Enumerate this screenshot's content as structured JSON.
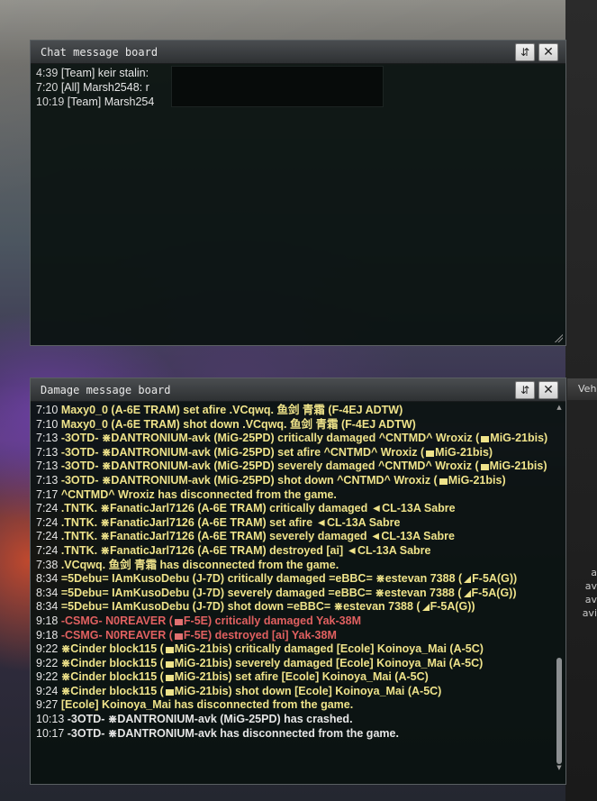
{
  "chat_board": {
    "title": "Chat message board",
    "sort_icon": "sort-arrows-icon",
    "close_icon": "close-icon",
    "messages": [
      {
        "time": "4:39",
        "text": "[Team] keir stalin:"
      },
      {
        "time": "7:20",
        "text": "[All] Marsh2548: r"
      },
      {
        "time": "10:19",
        "text": "[Team] Marsh254"
      }
    ]
  },
  "damage_board": {
    "title": "Damage message board",
    "lines": [
      {
        "time": "7:10",
        "parts": [
          "Maxy0_0 (A-6E TRAM) set afire .VCqwq. 鱼剑 青霜 (F-4EJ ADTW)"
        ],
        "style": "ally"
      },
      {
        "time": "7:10",
        "parts": [
          "Maxy0_0 (A-6E TRAM) shot down .VCqwq. 鱼剑 青霜 (F-4EJ ADTW)"
        ],
        "style": "ally"
      },
      {
        "time": "7:13",
        "parts": [
          "-3OTD- ⋇DANTRONIUM-avk (MiG-25PD) critically damaged ^CNTMD^ Wroxiz (",
          "MiG-21bis)"
        ],
        "icon": "square",
        "style": "ally"
      },
      {
        "time": "7:13",
        "parts": [
          "-3OTD- ⋇DANTRONIUM-avk (MiG-25PD) set afire ^CNTMD^ Wroxiz (",
          "MiG-21bis)"
        ],
        "icon": "square",
        "style": "ally"
      },
      {
        "time": "7:13",
        "parts": [
          "-3OTD- ⋇DANTRONIUM-avk (MiG-25PD) severely damaged ^CNTMD^ Wroxiz (",
          "MiG-21bis)"
        ],
        "icon": "square",
        "style": "ally"
      },
      {
        "time": "7:13",
        "parts": [
          "-3OTD- ⋇DANTRONIUM-avk (MiG-25PD) shot down ^CNTMD^ Wroxiz (",
          "MiG-21bis)"
        ],
        "icon": "square",
        "style": "ally"
      },
      {
        "time": "7:17",
        "parts": [
          "^CNTMD^ Wroxiz has disconnected from the game."
        ],
        "style": "ally"
      },
      {
        "time": "7:24",
        "parts": [
          ".TNTK. ⋇FanaticJarl7126 (A-6E TRAM) critically damaged ◄CL-13A Sabre"
        ],
        "style": "ally"
      },
      {
        "time": "7:24",
        "parts": [
          ".TNTK. ⋇FanaticJarl7126 (A-6E TRAM) set afire ◄CL-13A Sabre"
        ],
        "style": "ally"
      },
      {
        "time": "7:24",
        "parts": [
          ".TNTK. ⋇FanaticJarl7126 (A-6E TRAM) severely damaged ◄CL-13A Sabre"
        ],
        "style": "ally"
      },
      {
        "time": "7:24",
        "parts": [
          ".TNTK. ⋇FanaticJarl7126 (A-6E TRAM) destroyed [ai] ◄CL-13A Sabre"
        ],
        "style": "ally"
      },
      {
        "time": "7:38",
        "parts": [
          ".VCqwq. 鱼剑 青霜 has disconnected from the game."
        ],
        "style": "ally"
      },
      {
        "time": "8:34",
        "parts": [
          "=5Debu= IAmKusoDebu (J-7D) critically damaged =eBBC= ⋇estevan 7388 (",
          "F-5A(G))"
        ],
        "icon": "tri",
        "style": "ally"
      },
      {
        "time": "8:34",
        "parts": [
          "=5Debu= IAmKusoDebu (J-7D) severely damaged =eBBC= ⋇estevan 7388 (",
          "F-5A(G))"
        ],
        "icon": "tri",
        "style": "ally"
      },
      {
        "time": "8:34",
        "parts": [
          "=5Debu= IAmKusoDebu (J-7D) shot down =eBBC= ⋇estevan 7388 (",
          "F-5A(G))"
        ],
        "icon": "tri",
        "style": "ally"
      },
      {
        "time": "9:18",
        "parts": [
          "-CSMG- N0REAVER (",
          "F-5E) critically damaged Yak-38M"
        ],
        "icon": "square-red",
        "style": "enemy"
      },
      {
        "time": "9:18",
        "parts": [
          "-CSMG- N0REAVER (",
          "F-5E) destroyed [ai] Yak-38M"
        ],
        "icon": "square-red",
        "style": "enemy"
      },
      {
        "time": "9:22",
        "parts": [
          "⋇Cinder block115 (",
          "MiG-21bis) critically damaged [Ecole] Koinoya_Mai (A-5C)"
        ],
        "icon": "square",
        "style": "ally"
      },
      {
        "time": "9:22",
        "parts": [
          "⋇Cinder block115 (",
          "MiG-21bis) severely damaged [Ecole] Koinoya_Mai (A-5C)"
        ],
        "icon": "square",
        "style": "ally"
      },
      {
        "time": "9:22",
        "parts": [
          "⋇Cinder block115 (",
          "MiG-21bis) set afire [Ecole] Koinoya_Mai (A-5C)"
        ],
        "icon": "square",
        "style": "ally"
      },
      {
        "time": "9:24",
        "parts": [
          "⋇Cinder block115 (",
          "MiG-21bis) shot down [Ecole] Koinoya_Mai (A-5C)"
        ],
        "icon": "square",
        "style": "ally"
      },
      {
        "time": "9:27",
        "parts": [
          "[Ecole] Koinoya_Mai has disconnected from the game."
        ],
        "style": "ally"
      },
      {
        "time": "10:13",
        "parts": [
          "-3OTD- ⋇DANTRONIUM-avk (MiG-25PD) has crashed."
        ],
        "style": "sys"
      },
      {
        "time": "10:17",
        "parts": [
          "-3OTD- ⋇DANTRONIUM-avk has disconnected from the game."
        ],
        "style": "sys"
      }
    ]
  },
  "right_panel": {
    "tab_label": "Veh",
    "side_lines": [
      "a",
      "av",
      "av",
      "avi"
    ]
  },
  "colors": {
    "ally_text": "#efe38a",
    "enemy_text": "#e06060",
    "system_text": "#e6e6e6"
  }
}
